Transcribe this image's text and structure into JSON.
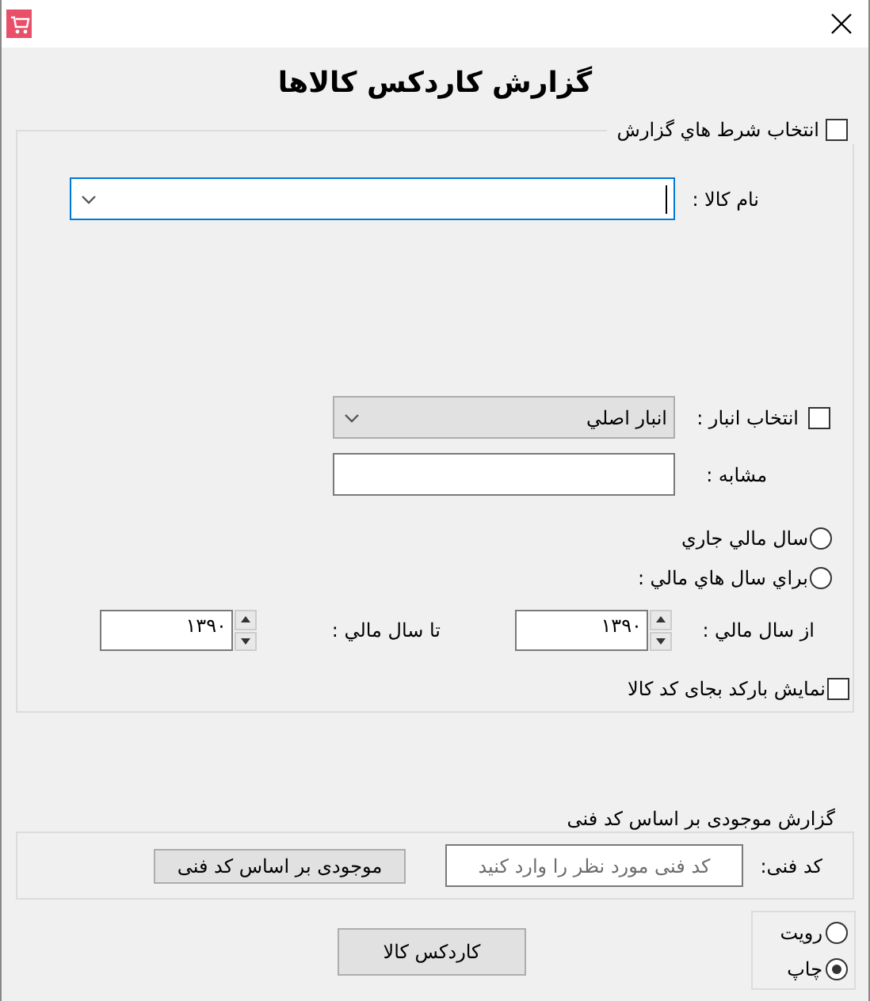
{
  "heading": "گزارش کاردکس کالاها",
  "conditions": {
    "label": "انتخاب شرط هاي گزارش",
    "checked": false
  },
  "item_name": {
    "label": "نام کالا :",
    "focused": true
  },
  "warehouse": {
    "label": "انتخاب انبار :",
    "checked": false,
    "value": "انبار اصلي",
    "disabled": true
  },
  "similar": {
    "label": "مشابه :"
  },
  "year_options": [
    {
      "label": "سال مالي جاري",
      "selected": false
    },
    {
      "label": "براي سال هاي مالي :",
      "selected": false
    }
  ],
  "from_year": {
    "label": "از سال مالي :",
    "value": "۱۳۹۰"
  },
  "to_year": {
    "label": "تا سال مالي :",
    "value": "۱۳۹۰"
  },
  "barcode": {
    "label": "نمایش بارکد بجای کد کالا",
    "checked": false
  },
  "tech_code": {
    "title": "گزارش موجودی بر اساس کد فنی",
    "label": "کد فنی:",
    "placeholder": "کد فنی مورد نظر را وارد کنید",
    "button": "موجودی بر اساس کد فنی"
  },
  "output_options": [
    {
      "label": "رویت",
      "selected": false
    },
    {
      "label": "چاپ",
      "selected": true
    }
  ],
  "main_button": "کاردکس کالا"
}
